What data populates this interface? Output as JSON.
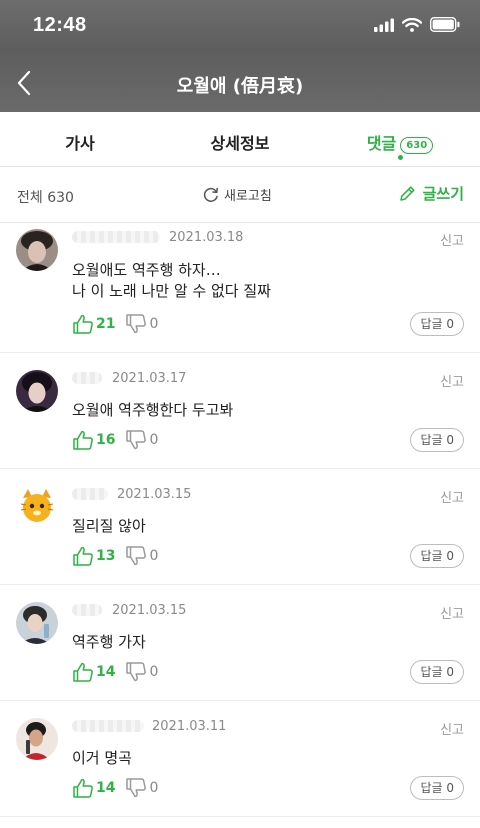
{
  "status": {
    "time": "12:48"
  },
  "song": {
    "title": "오월애 (俉月哀)"
  },
  "tabs": [
    {
      "label": "가사",
      "count": ""
    },
    {
      "label": "상세정보",
      "count": ""
    },
    {
      "label": "댓글",
      "count": "630"
    }
  ],
  "toolbar": {
    "total_label": "전체 630",
    "refresh_label": "새로고침",
    "write_label": "글쓰기"
  },
  "comments": [
    {
      "date": "2021.03.18",
      "report": "신고",
      "text": "오월애도 역주행 하자…\n나 이 노래 나만 알 수 없다 질짜",
      "likes": "21",
      "dislikes": "0",
      "reply": "답글 0"
    },
    {
      "date": "2021.03.17",
      "report": "신고",
      "text": "오월애 역주행한다 두고봐",
      "likes": "16",
      "dislikes": "0",
      "reply": "답글 0"
    },
    {
      "date": "2021.03.15",
      "report": "신고",
      "text": "질리질 않아",
      "likes": "13",
      "dislikes": "0",
      "reply": "답글 0"
    },
    {
      "date": "2021.03.15",
      "report": "신고",
      "text": "역주행 가자",
      "likes": "14",
      "dislikes": "0",
      "reply": "답글 0"
    },
    {
      "date": "2021.03.11",
      "report": "신고",
      "text": "이거 명곡",
      "likes": "14",
      "dislikes": "0",
      "reply": "답글 0"
    }
  ],
  "colors": {
    "accent": "#2fb246",
    "header_bg": "#666666"
  },
  "icons": [
    "back-arrow-icon",
    "refresh-icon",
    "pencil-icon",
    "thumbs-up-icon",
    "thumbs-down-icon",
    "signal-icon",
    "wifi-icon",
    "battery-icon"
  ]
}
